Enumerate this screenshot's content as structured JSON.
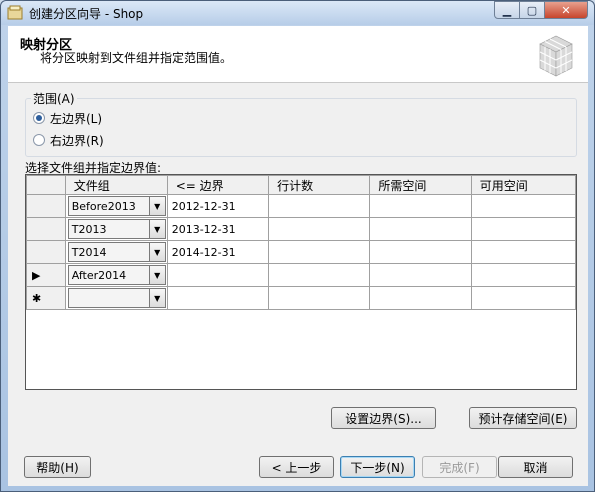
{
  "window": {
    "title": "创建分区向导 - Shop"
  },
  "header": {
    "title": "映射分区",
    "subtitle": "将分区映射到文件组并指定范围值。"
  },
  "range": {
    "legend": "范围(A)",
    "options": [
      {
        "label": "左边界(L)",
        "checked": true
      },
      {
        "label": "右边界(R)",
        "checked": false
      }
    ]
  },
  "grid": {
    "label": "选择文件组并指定边界值:",
    "columns": [
      "文件组",
      "<= 边界",
      "行计数",
      "所需空间",
      "可用空间"
    ],
    "rows": [
      {
        "marker": "",
        "filegroup": "Before2013",
        "boundary": "2012-12-31",
        "rowcount": "",
        "required": "",
        "available": ""
      },
      {
        "marker": "",
        "filegroup": "T2013",
        "boundary": "2013-12-31",
        "rowcount": "",
        "required": "",
        "available": ""
      },
      {
        "marker": "",
        "filegroup": "T2014",
        "boundary": "2014-12-31",
        "rowcount": "",
        "required": "",
        "available": ""
      },
      {
        "marker": "▶",
        "filegroup": "After2014",
        "boundary": "",
        "rowcount": "",
        "required": "",
        "available": ""
      },
      {
        "marker": "✱",
        "filegroup": "",
        "boundary": "",
        "rowcount": "",
        "required": "",
        "available": ""
      }
    ]
  },
  "actions": {
    "set_boundaries": "设置边界(S)...",
    "estimate_storage": "预计存储空间(E)"
  },
  "footer": {
    "help": "帮助(H)",
    "back": "< 上一步",
    "next": "下一步(N)",
    "finish": "完成(F)",
    "cancel": "取消"
  },
  "colors": {
    "accent": "#3c7fb1",
    "titlebar": "#b7cde8",
    "close": "#c7452c"
  }
}
